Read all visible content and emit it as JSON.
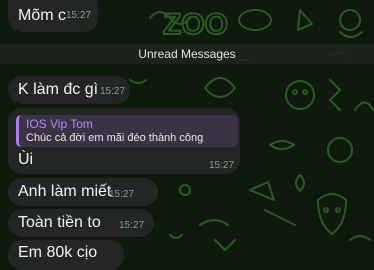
{
  "theme": {
    "bubble_color": "#242625",
    "accent_color": "#b07cf0",
    "background_color": "#0d1a0c"
  },
  "divider": {
    "label": "Unread Messages"
  },
  "messages": [
    {
      "text": "Mõm c",
      "time": "15:27"
    },
    {
      "text": "K làm đc gì",
      "time": "15:27"
    },
    {
      "reply": {
        "name": "IOS Vip Tom",
        "text": "Chúc cả đời em mãi đéo thành công"
      },
      "text": "Ùi",
      "time": "15:27"
    },
    {
      "text": "Anh làm miết",
      "time": "15:27"
    },
    {
      "text": "Toàn tiền to",
      "time": "15:27"
    },
    {
      "text": "Em 80k cịo",
      "time": ""
    }
  ]
}
